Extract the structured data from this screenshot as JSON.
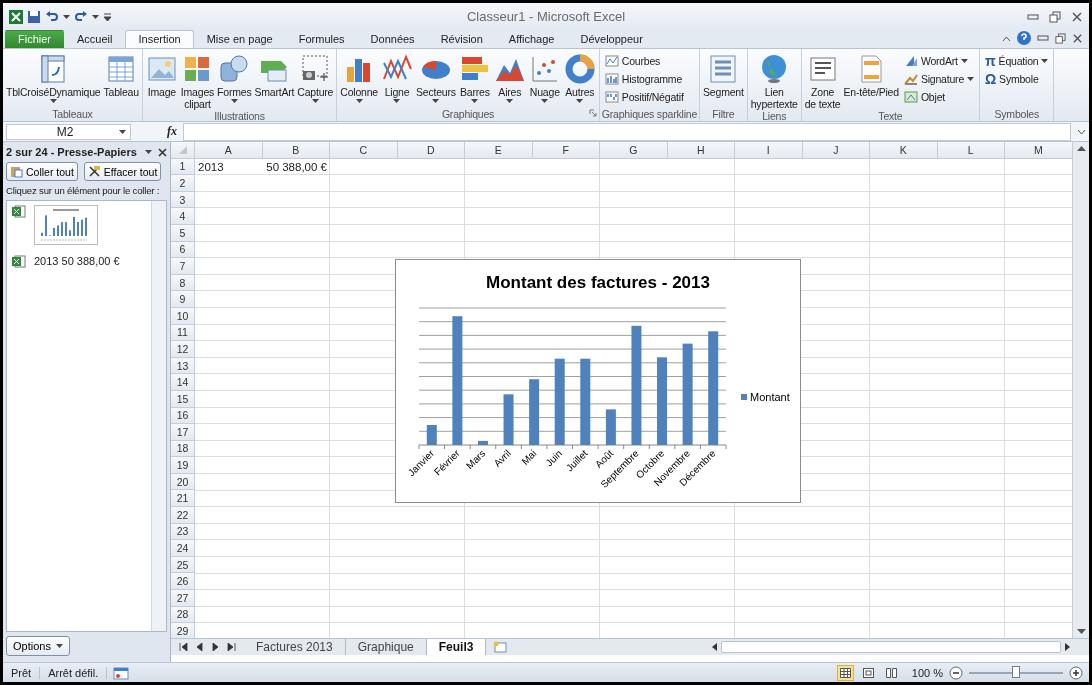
{
  "window": {
    "title": "Classeur1 - Microsoft Excel"
  },
  "ribbon_tabs": [
    {
      "label": "Fichier",
      "kind": "file",
      "selected": false
    },
    {
      "label": "Accueil",
      "kind": "tab",
      "selected": false
    },
    {
      "label": "Insertion",
      "kind": "tab",
      "selected": true
    },
    {
      "label": "Mise en page",
      "kind": "tab",
      "selected": false
    },
    {
      "label": "Formules",
      "kind": "tab",
      "selected": false
    },
    {
      "label": "Données",
      "kind": "tab",
      "selected": false
    },
    {
      "label": "Révision",
      "kind": "tab",
      "selected": false
    },
    {
      "label": "Affichage",
      "kind": "tab",
      "selected": false
    },
    {
      "label": "Développeur",
      "kind": "tab",
      "selected": false
    }
  ],
  "ribbon_groups": [
    {
      "label": "Tableaux",
      "launcher": false,
      "buttons": [
        {
          "kind": "large",
          "label": "TblCroiséDynamique",
          "dropdown": true
        },
        {
          "kind": "large",
          "label": "Tableau",
          "dropdown": false
        }
      ]
    },
    {
      "label": "Illustrations",
      "launcher": false,
      "buttons": [
        {
          "kind": "large",
          "label": "Image",
          "dropdown": false
        },
        {
          "kind": "large",
          "label": "Images\nclipart",
          "dropdown": false
        },
        {
          "kind": "large",
          "label": "Formes",
          "dropdown": true
        },
        {
          "kind": "large",
          "label": "SmartArt",
          "dropdown": false
        },
        {
          "kind": "large",
          "label": "Capture",
          "dropdown": true
        }
      ]
    },
    {
      "label": "Graphiques",
      "launcher": true,
      "buttons": [
        {
          "kind": "large",
          "label": "Colonne",
          "dropdown": true
        },
        {
          "kind": "large",
          "label": "Ligne",
          "dropdown": true
        },
        {
          "kind": "large",
          "label": "Secteurs",
          "dropdown": true
        },
        {
          "kind": "large",
          "label": "Barres",
          "dropdown": true
        },
        {
          "kind": "large",
          "label": "Aires",
          "dropdown": true
        },
        {
          "kind": "large",
          "label": "Nuage",
          "dropdown": true
        },
        {
          "kind": "large",
          "label": "Autres",
          "dropdown": true
        }
      ]
    },
    {
      "label": "Graphiques sparkline",
      "launcher": false,
      "buttons": [
        {
          "kind": "small",
          "label": "Courbes",
          "dropdown": false
        },
        {
          "kind": "small",
          "label": "Histogramme",
          "dropdown": false
        },
        {
          "kind": "small",
          "label": "Positif/Négatif",
          "dropdown": false
        }
      ]
    },
    {
      "label": "Filtre",
      "launcher": false,
      "buttons": [
        {
          "kind": "large",
          "label": "Segment",
          "dropdown": false
        }
      ]
    },
    {
      "label": "Liens",
      "launcher": false,
      "buttons": [
        {
          "kind": "large",
          "label": "Lien\nhypertexte",
          "dropdown": false
        }
      ]
    },
    {
      "label": "Texte",
      "launcher": false,
      "buttons": [
        {
          "kind": "large",
          "label": "Zone\nde texte",
          "dropdown": false
        },
        {
          "kind": "large",
          "label": "En-tête/Pied",
          "dropdown": false
        },
        {
          "kind": "small",
          "label": "WordArt",
          "dropdown": true
        },
        {
          "kind": "small",
          "label": "Signature",
          "dropdown": true
        },
        {
          "kind": "small",
          "label": "Objet",
          "dropdown": false
        }
      ]
    },
    {
      "label": "Symboles",
      "launcher": false,
      "buttons": [
        {
          "kind": "small",
          "glyph": "π",
          "label": "Équation",
          "dropdown": true
        },
        {
          "kind": "small",
          "glyph": "Ω",
          "label": "Symbole",
          "dropdown": false
        }
      ]
    }
  ],
  "formula_bar": {
    "name_box": "M2",
    "fx": "fx"
  },
  "clipboard": {
    "title": "2 sur 24 - Presse-Papiers",
    "buttons": [
      "Coller tout",
      "Effacer tout"
    ],
    "hint": "Cliquez sur un élément pour le coller :",
    "items": [
      {
        "kind": "image"
      },
      {
        "kind": "text",
        "text": "2013 50 388,00 €"
      }
    ],
    "options": "Options"
  },
  "columns": [
    "A",
    "B",
    "C",
    "D",
    "E",
    "F",
    "G",
    "H",
    "I",
    "J",
    "K",
    "L",
    "M"
  ],
  "rows": [
    {
      "number": "1",
      "cells": [
        {
          "kind": "text",
          "text": "2013"
        },
        {
          "kind": "number",
          "text": "50 388,00 €"
        }
      ]
    },
    {
      "number": "2"
    },
    {
      "number": "3"
    },
    {
      "number": "4"
    },
    {
      "number": "5"
    },
    {
      "number": "6"
    },
    {
      "number": "7"
    },
    {
      "number": "8"
    },
    {
      "number": "9"
    },
    {
      "number": "10"
    },
    {
      "number": "11"
    },
    {
      "number": "12"
    },
    {
      "number": "13"
    },
    {
      "number": "14"
    },
    {
      "number": "15"
    },
    {
      "number": "16"
    },
    {
      "number": "17"
    },
    {
      "number": "18"
    },
    {
      "number": "19"
    },
    {
      "number": "20"
    },
    {
      "number": "21"
    },
    {
      "number": "22"
    },
    {
      "number": "23"
    },
    {
      "number": "24"
    },
    {
      "number": "25"
    },
    {
      "number": "26"
    },
    {
      "number": "27"
    },
    {
      "number": "28"
    },
    {
      "number": "29"
    }
  ],
  "chart": {
    "title": "Montant des factures - 2013",
    "legend": "Montant",
    "categories": [
      "Janvier",
      "Février",
      "Mars",
      "Avril",
      "Mai",
      "Juin",
      "Juillet",
      "Août",
      "Septembre",
      "Octobre",
      "Novembre",
      "Décembre"
    ]
  },
  "sheet_tabs": [
    {
      "label": "Factures 2013",
      "selected": false
    },
    {
      "label": "Graphique",
      "selected": false
    },
    {
      "label": "Feuil3",
      "selected": true
    }
  ],
  "status_bar": {
    "items": [
      "Prêt",
      "Arrêt défil."
    ],
    "views": [
      {
        "selected": true
      },
      {
        "selected": false
      },
      {
        "selected": false
      }
    ],
    "zoom": "100 %",
    "zoom_slider": {
      "level": 0.5
    }
  }
}
